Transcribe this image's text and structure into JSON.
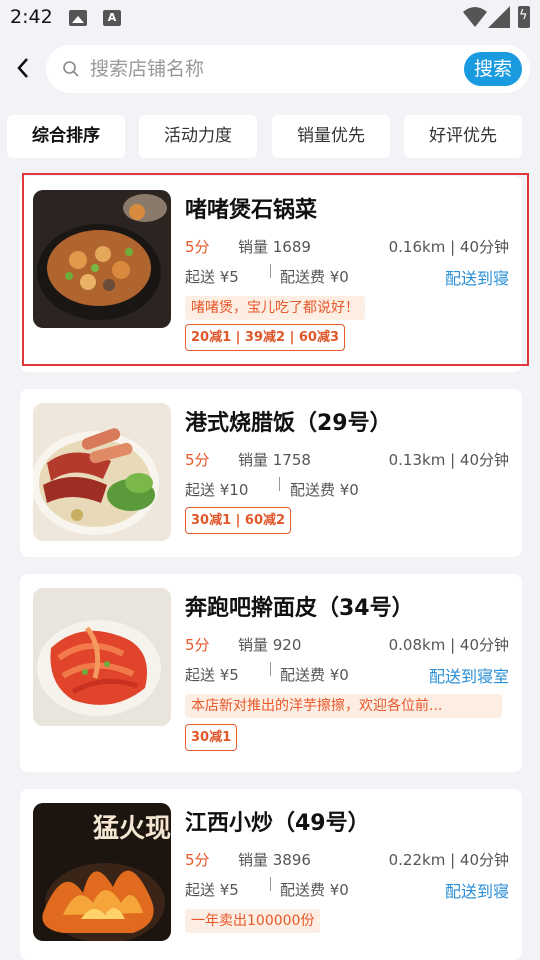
{
  "status_bar": {
    "time": "2:42",
    "a_icon": "A"
  },
  "search": {
    "placeholder": "搜索店铺名称",
    "button_label": "搜索"
  },
  "sort_tabs": [
    "综合排序",
    "活动力度",
    "销量优先",
    "好评优先"
  ],
  "shops": [
    {
      "name": "啫啫煲石锅菜",
      "score": "5分",
      "sales": "销量 1689",
      "distance": "0.16km | 40分钟",
      "min_order": "起送 ¥5",
      "delivery_fee": "配送费 ¥0",
      "deliver_tag": "配送到寝",
      "slogan": "啫啫煲，宝儿吃了都说好！",
      "promo": "20减1 | 39减2 | 60减3"
    },
    {
      "name": "港式烧腊饭（29号）",
      "score": "5分",
      "sales": "销量 1758",
      "distance": "0.13km | 40分钟",
      "min_order": "起送 ¥10",
      "delivery_fee": "配送费 ¥0",
      "promo": "30减1 | 60减2"
    },
    {
      "name": "奔跑吧擀面皮（34号）",
      "score": "5分",
      "sales": "销量 920",
      "distance": "0.08km | 40分钟",
      "min_order": "起送 ¥5",
      "delivery_fee": "配送费 ¥0",
      "deliver_tag": "配送到寝室",
      "slogan": "本店新对推出的洋芋擦擦，欢迎各位前...",
      "promo": "30减1"
    },
    {
      "name": "江西小炒（49号）",
      "score": "5分",
      "sales": "销量 3896",
      "distance": "0.22km | 40分钟",
      "min_order": "起送 ¥5",
      "delivery_fee": "配送费 ¥0",
      "deliver_tag": "配送到寝",
      "slogan": "一年卖出100000份",
      "image_text": "猛火现炒"
    }
  ],
  "colors": {
    "accent_blue": "#1a9be0",
    "accent_orange": "#e8582a",
    "highlight_red": "#e0383a"
  },
  "icons": [
    "back-arrow-icon",
    "search-icon",
    "wifi-icon",
    "signal-icon",
    "battery-icon",
    "image-icon"
  ]
}
